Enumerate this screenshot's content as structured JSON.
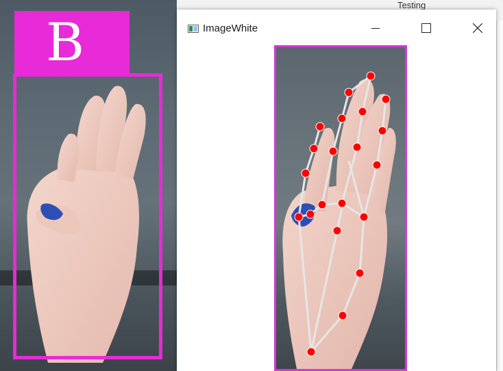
{
  "camera": {
    "predicted_letter": "B",
    "box_color": "#e82ad8"
  },
  "background_app": {
    "text": "Testing"
  },
  "window": {
    "title": "ImageWhite",
    "icon": "image-window-icon",
    "controls": [
      "minimize-icon",
      "maximize-icon",
      "close-icon"
    ]
  },
  "landmarks": {
    "count": 21,
    "point_color": "#ff0000",
    "line_color": "#e6e6e6"
  }
}
